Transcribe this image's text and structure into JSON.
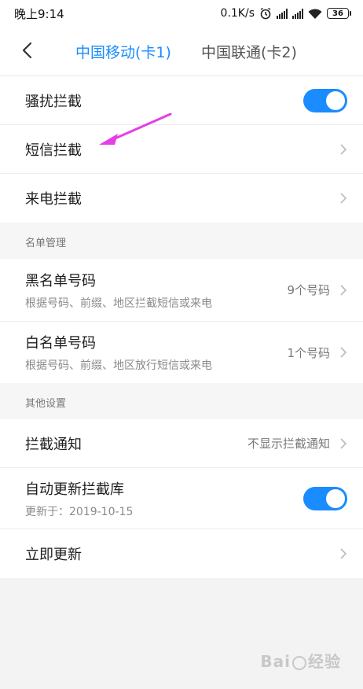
{
  "status": {
    "time": "晚上9:14",
    "net_speed": "0.1K/s",
    "battery": "36"
  },
  "header": {
    "tabs": [
      {
        "label": "中国移动(卡1)",
        "active": true
      },
      {
        "label": "中国联通(卡2)",
        "active": false
      }
    ]
  },
  "section1": {
    "rows": [
      {
        "label": "骚扰拦截",
        "toggle": true
      },
      {
        "label": "短信拦截"
      },
      {
        "label": "来电拦截"
      }
    ]
  },
  "section2": {
    "header": "名单管理",
    "rows": [
      {
        "label": "黑名单号码",
        "sub": "根据号码、前缀、地区拦截短信或来电",
        "value": "9个号码"
      },
      {
        "label": "白名单号码",
        "sub": "根据号码、前缀、地区放行短信或来电",
        "value": "1个号码"
      }
    ]
  },
  "section3": {
    "header": "其他设置",
    "rows": [
      {
        "label": "拦截通知",
        "value": "不显示拦截通知"
      },
      {
        "label": "自动更新拦截库",
        "sub": "更新于：2019-10-15",
        "toggle": true
      },
      {
        "label": "立即更新"
      }
    ]
  },
  "colors": {
    "accent": "#1a8cff",
    "arrow": "#e63ee6"
  },
  "watermark": {
    "text_left": "Bai",
    "text_right": "经验"
  }
}
